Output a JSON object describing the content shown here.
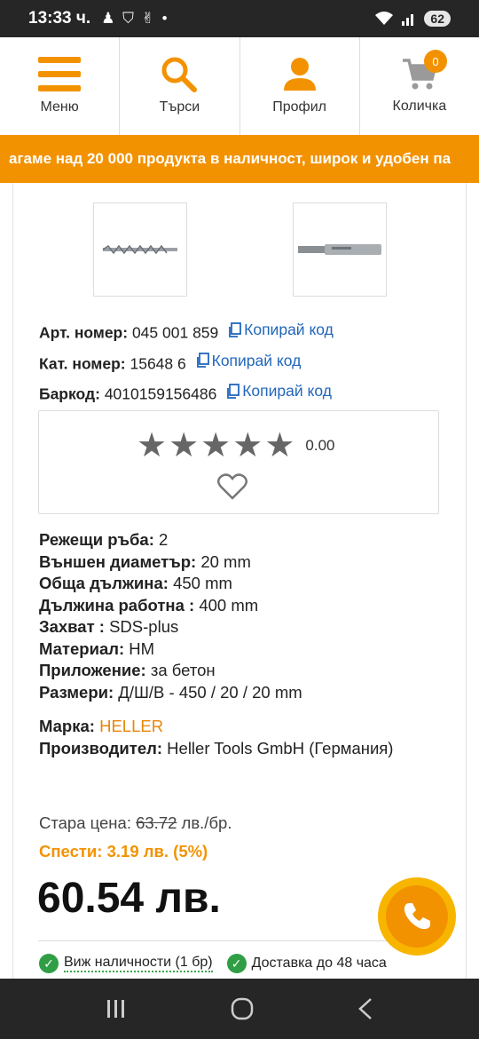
{
  "status_bar": {
    "time": "13:33 ч.",
    "icons": "♟ ⛉ ✌ •",
    "battery": "62"
  },
  "nav": [
    {
      "label": "Меню"
    },
    {
      "label": "Търси"
    },
    {
      "label": "Профил"
    },
    {
      "label": "Количка",
      "badge": "0"
    }
  ],
  "banner": {
    "text": "агаме над 20 000 продукта в наличност, широк и удобен па"
  },
  "product": {
    "codes": [
      {
        "key": "Арт. номер:",
        "value": "045 001 859",
        "copy": "Копирай код"
      },
      {
        "key": "Кат. номер:",
        "value": "15648 6",
        "copy": "Копирай код"
      },
      {
        "key": "Баркод:",
        "value": "4010159156486",
        "copy": "Копирай код"
      }
    ],
    "rating": {
      "value": "0.00",
      "stars": 5
    },
    "specs": [
      {
        "key": "Режещи ръба:",
        "value": " 2"
      },
      {
        "key": "Външен диаметър:",
        "value": " 20 mm"
      },
      {
        "key": "Обща дължина:",
        "value": " 450 mm"
      },
      {
        "key": "Дължина работна :",
        "value": " 400 mm"
      },
      {
        "key": "Захват :",
        "value": " SDS-plus"
      },
      {
        "key": "Материал:",
        "value": " HM"
      },
      {
        "key": "Приложение:",
        "value": " за бетон"
      },
      {
        "key": "Размери:",
        "value": " Д/Ш/В - 450 / 20 / 20 mm"
      }
    ],
    "brand": {
      "key": "Марка:",
      "value": " HELLER"
    },
    "manufacturer": {
      "key": "Производител:",
      "value": " Heller Tools GmbH (Германия)"
    },
    "price": {
      "old_label": "Стара цена: ",
      "old_value": "63.72",
      "old_unit": " лв./бр.",
      "save": "Спести: 3.19 лв. (5%)",
      "current": "60.54 лв."
    },
    "availability": [
      {
        "text": "Виж наличности (1 бр)"
      },
      {
        "text": "Доставка до 48 часа"
      }
    ]
  },
  "colors": {
    "accent": "#f39200",
    "link": "#2266bb",
    "ok": "#2f9e44"
  }
}
